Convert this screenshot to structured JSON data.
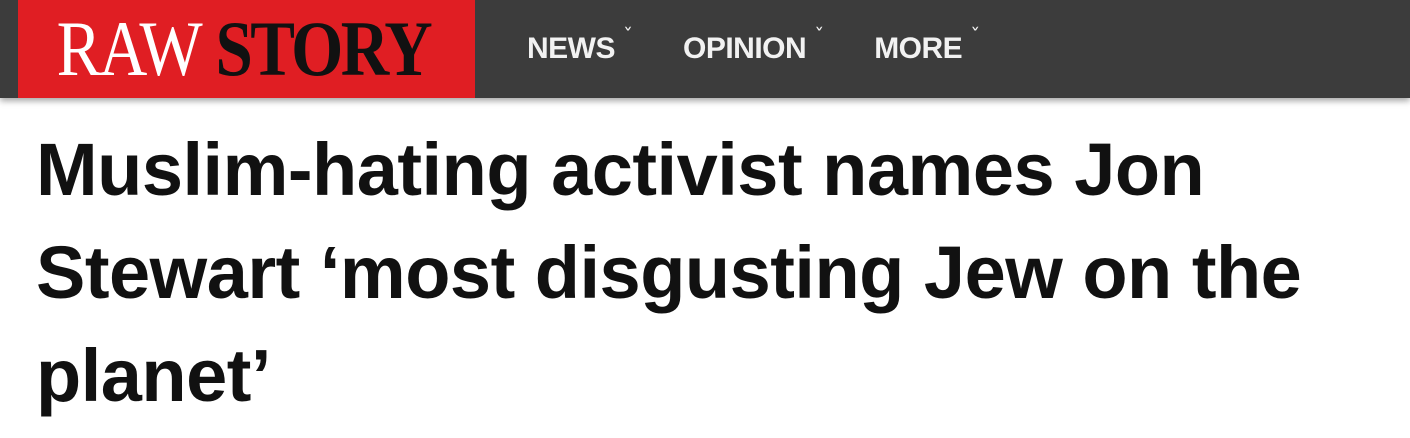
{
  "site": {
    "logo_part1": "RAW",
    "logo_part2": "STORY",
    "brand_color": "#e01e23",
    "header_bg": "#3c3c3c"
  },
  "nav": {
    "items": [
      {
        "label": "NEWS",
        "icon": "caret-down-icon"
      },
      {
        "label": "OPINION",
        "icon": "caret-down-icon"
      },
      {
        "label": "MORE",
        "icon": "caret-down-icon"
      }
    ]
  },
  "article": {
    "headline": "Muslim-hating activist names Jon Stewart ‘most disgusting Jew on the planet’"
  }
}
